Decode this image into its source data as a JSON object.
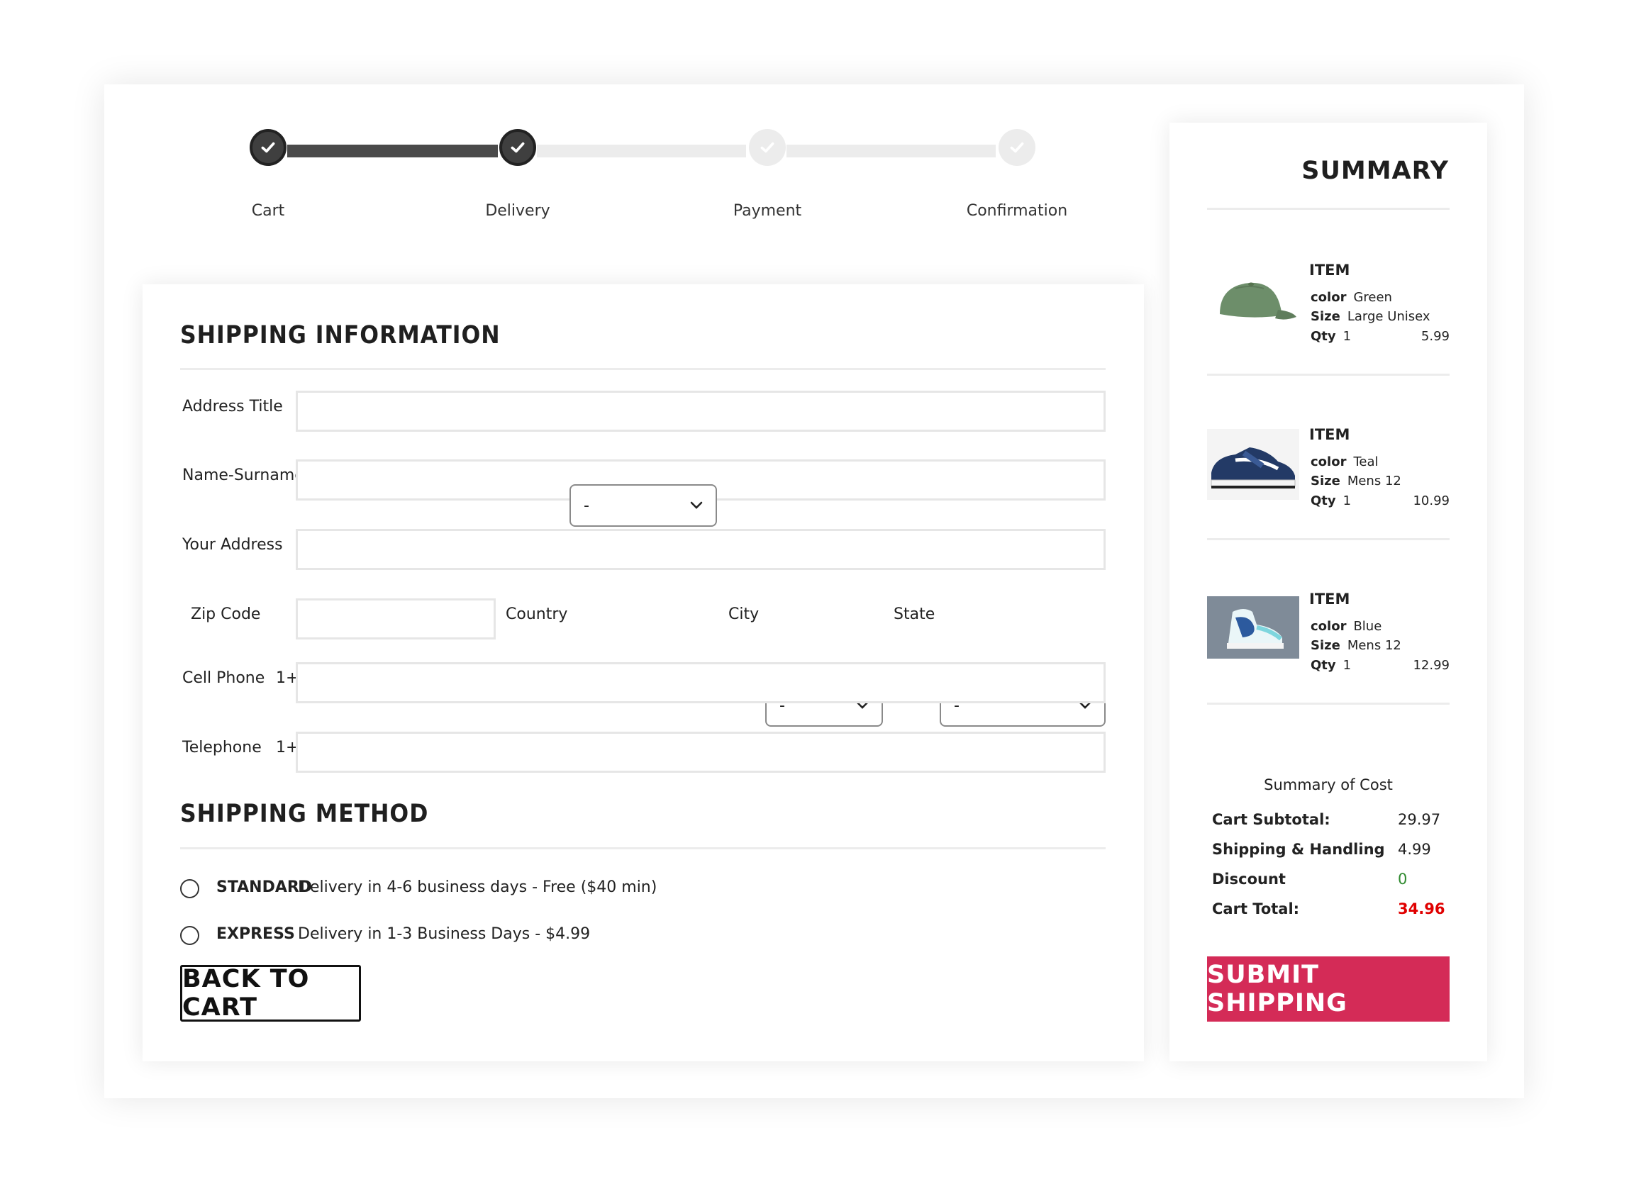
{
  "stepper": {
    "steps": [
      {
        "label": "Cart",
        "done": true
      },
      {
        "label": "Delivery",
        "done": true
      },
      {
        "label": "Payment",
        "done": false
      },
      {
        "label": "Confirmation",
        "done": false
      }
    ]
  },
  "shipping": {
    "title": "SHIPPING INFORMATION",
    "fields": {
      "address_title": {
        "label": "Address Title",
        "value": ""
      },
      "name_surname": {
        "label": "Name-Surname",
        "value": ""
      },
      "your_address": {
        "label": "Your Address",
        "value": ""
      },
      "zip_code": {
        "label": "Zip Code",
        "value": ""
      },
      "country": {
        "label": "Country",
        "selected": "-"
      },
      "city": {
        "label": "City",
        "selected": "-"
      },
      "state": {
        "label": "State",
        "selected": "-"
      },
      "cell_phone": {
        "label": "Cell Phone",
        "prefix": "1+",
        "value": ""
      },
      "telephone": {
        "label": "Telephone",
        "prefix": "1+",
        "value": ""
      }
    }
  },
  "method": {
    "title": "SHIPPING METHOD",
    "options": [
      {
        "name": "STANDARD",
        "desc": "Delivery in 4-6 business days - Free ($40 min)"
      },
      {
        "name": "EXPRESS",
        "desc": "Delivery in 1-3 Business Days - $4.99"
      }
    ],
    "back_label": "BACK TO CART"
  },
  "summary": {
    "title": "SUMMARY",
    "item_header": "ITEM",
    "labels": {
      "color": "color",
      "size": "Size",
      "qty": "Qty"
    },
    "items": [
      {
        "color": "Green",
        "size": "Large Unisex",
        "qty": "1",
        "price": "5.99",
        "icon": "cap-icon"
      },
      {
        "color": "Teal",
        "size": "Mens 12",
        "qty": "1",
        "price": "10.99",
        "icon": "sneaker-icon"
      },
      {
        "color": "Blue",
        "size": "Mens 12",
        "qty": "1",
        "price": "12.99",
        "icon": "high-top-sneaker-icon"
      }
    ],
    "cost": {
      "title": "Summary of Cost",
      "subtotal_label": "Cart Subtotal:",
      "subtotal": "29.97",
      "shipping_label": "Shipping & Handling",
      "shipping": "4.99",
      "discount_label": "Discount",
      "discount": "0",
      "total_label": "Cart Total:",
      "total": "34.96"
    },
    "submit_label": "SUBMIT SHIPPING"
  },
  "colors": {
    "accent": "#d42b57",
    "total_red": "#e00000",
    "discount_green": "#2f8a2f",
    "step_done": "#3f3f3f",
    "step_pending": "#ececec"
  }
}
